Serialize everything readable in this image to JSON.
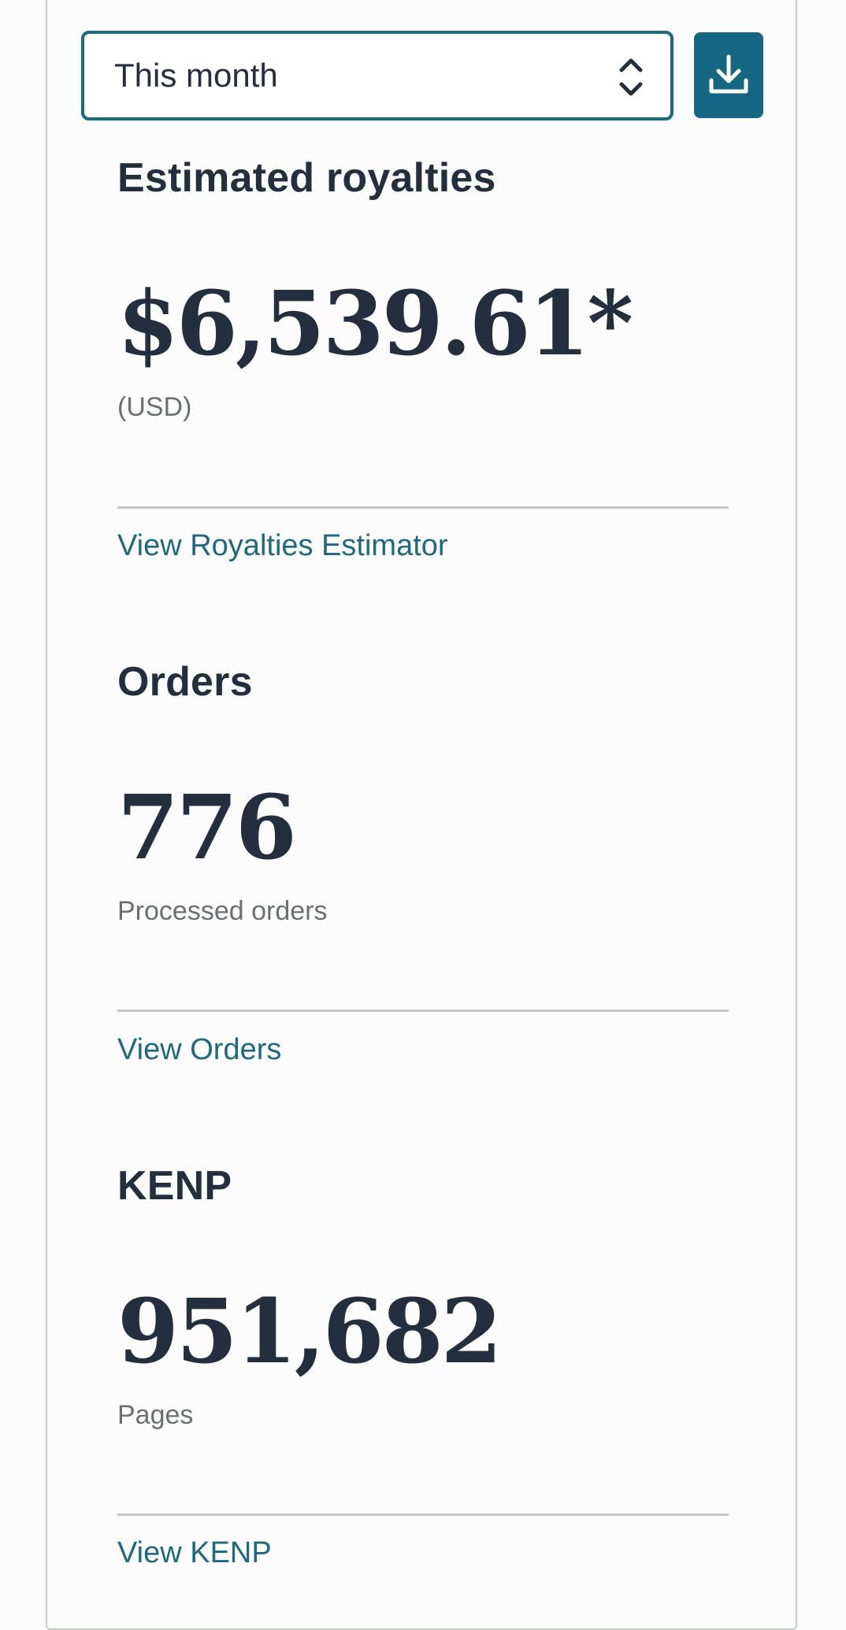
{
  "filter": {
    "selected": "This month"
  },
  "toolbar": {
    "download_icon": "download-icon"
  },
  "royalties": {
    "heading": "Estimated royalties",
    "value": "$6,539.61*",
    "sub_label": "(USD)",
    "link": "View Royalties Estimator"
  },
  "orders": {
    "heading": "Orders",
    "value": "776",
    "sub_label": "Processed orders",
    "link": "View Orders"
  },
  "kenp": {
    "heading": "KENP",
    "value": "951,682",
    "sub_label": "Pages",
    "link": "View KENP"
  },
  "colors": {
    "accent": "#146683",
    "text": "#232f3e",
    "link": "#1c6a82",
    "muted": "#6b6f74"
  }
}
